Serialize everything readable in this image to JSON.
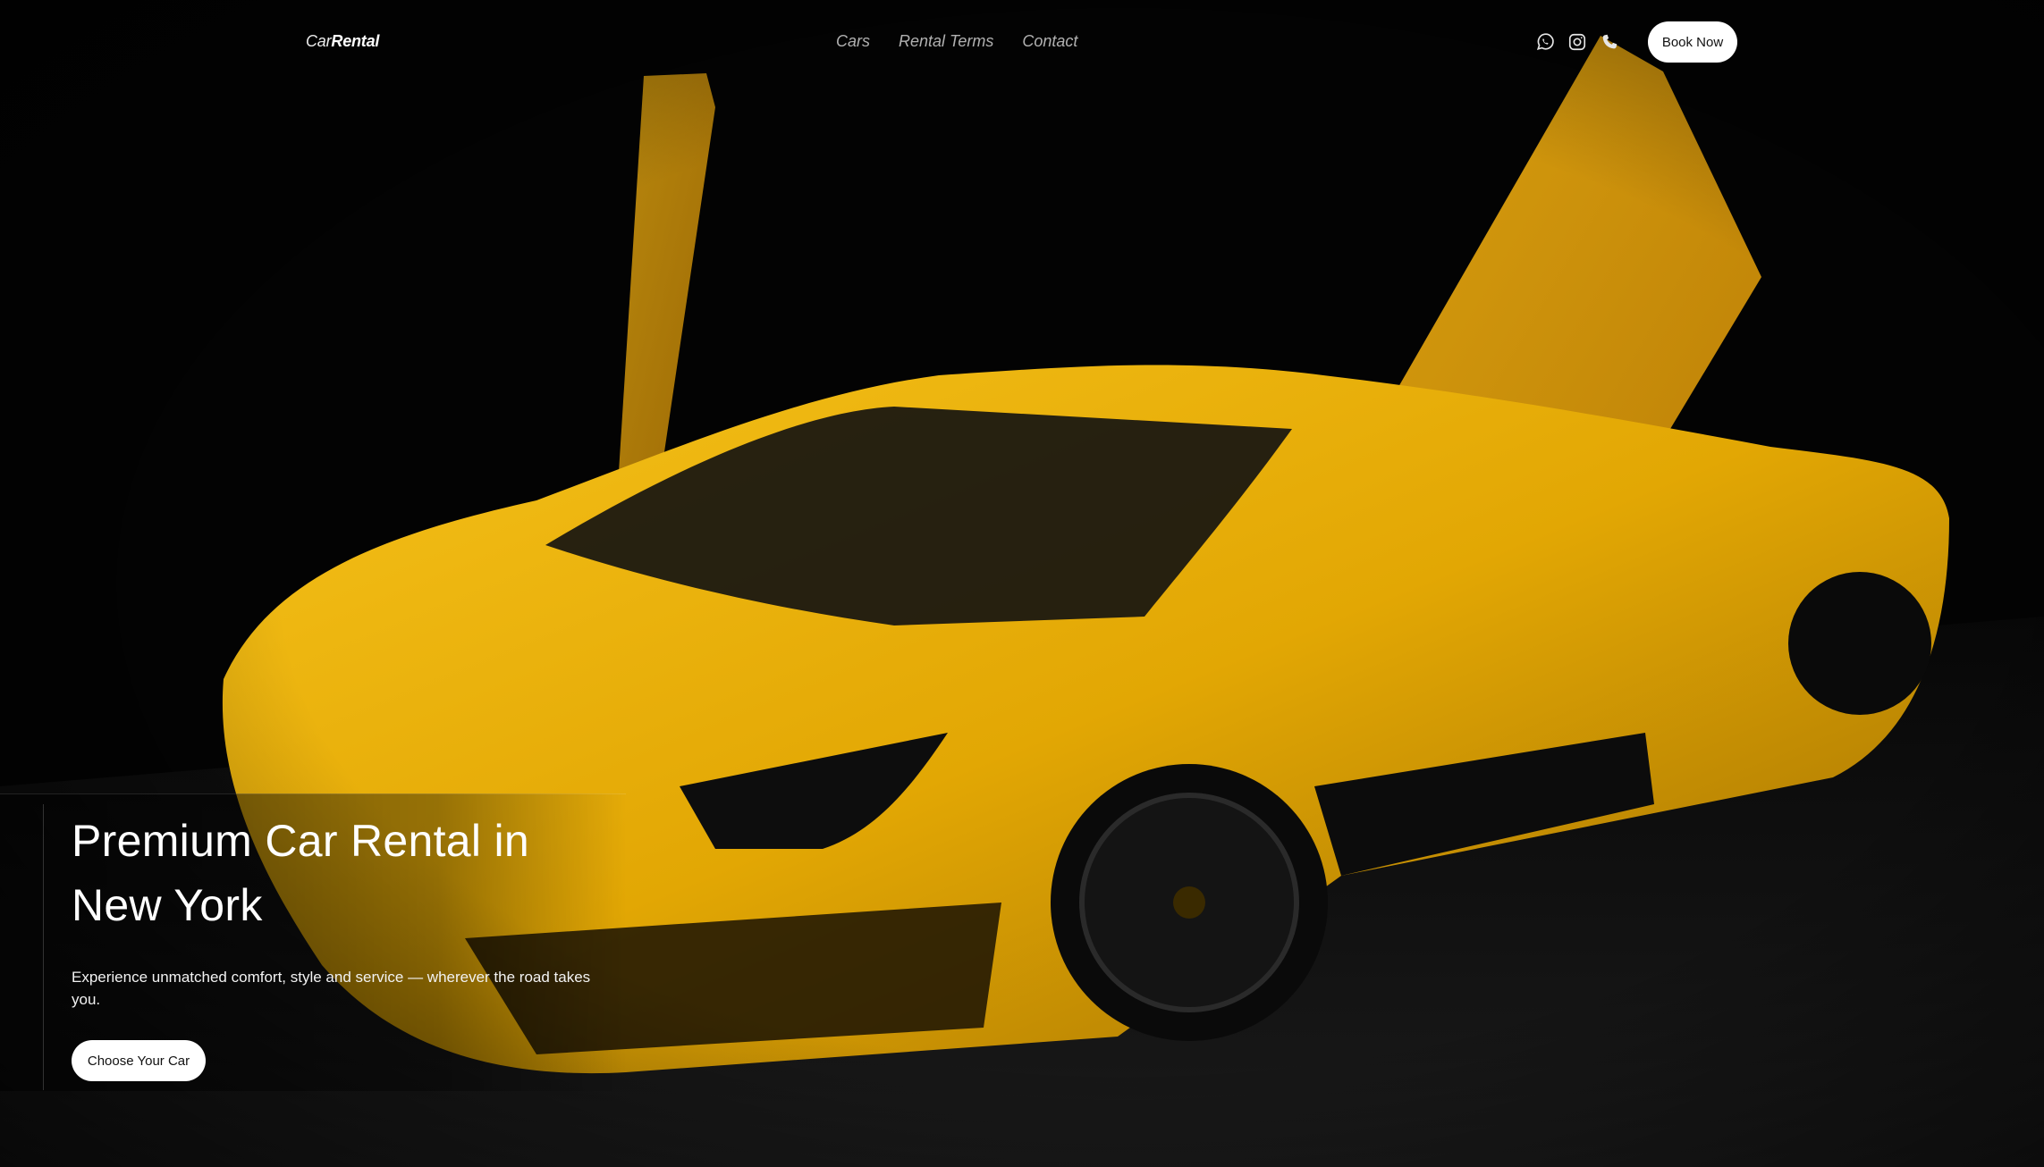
{
  "brand": {
    "logo_light": "Car",
    "logo_bold": "Rental"
  },
  "nav": {
    "items": [
      {
        "label": "Cars"
      },
      {
        "label": "Rental Terms"
      },
      {
        "label": "Contact"
      }
    ]
  },
  "social": {
    "icons": [
      "whatsapp-icon",
      "instagram-icon",
      "phone-icon"
    ]
  },
  "header": {
    "book_label": "Book Now"
  },
  "hero": {
    "title": "Premium Car Rental in New York",
    "subtitle": "Experience unmatched comfort, style and service — wherever the road takes you.",
    "cta_label": "Choose Your Car"
  },
  "colors": {
    "background": "#030303",
    "car_yellow": "#f2b705",
    "button_bg": "#ffffff",
    "button_text": "#111111"
  }
}
